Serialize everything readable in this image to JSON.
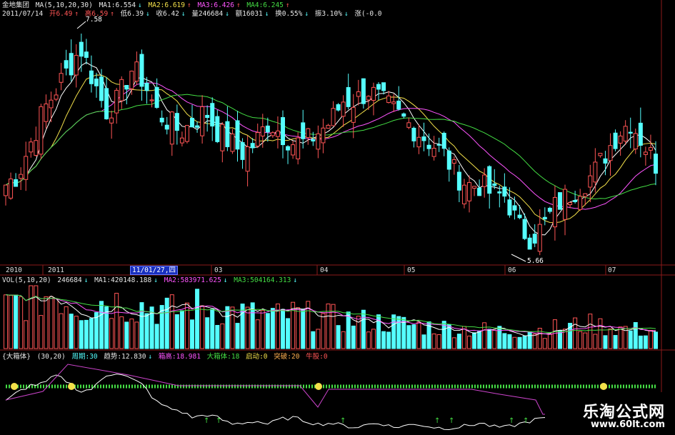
{
  "header": {
    "stock_name": "金地集团",
    "ma_params": "MA(5,10,20,30)",
    "ma1": "MA1:6.554",
    "ma2": "MA2:6.619",
    "ma3": "MA3:6.426",
    "ma4": "MA4:6.245",
    "date": "2011/07/14",
    "open": "开6.49",
    "high": "高6.59",
    "low": "低6.39",
    "close": "收6.42",
    "volume": "量246684",
    "amount": "额16031",
    "turnover": "换0.55%",
    "amplitude": "振3.10%",
    "change": "涨(-0.0"
  },
  "price_labels": {
    "max": "7.58",
    "min": "5.66"
  },
  "x_axis": {
    "labels": [
      "2010",
      "2011",
      "04",
      "05",
      "06",
      "07"
    ],
    "cursor_label": "11/01/27,四",
    "extra_label": "03"
  },
  "volume_header": {
    "params": "VOL(5,10,20)",
    "value": "246684",
    "ma1": "MA1:420148.188",
    "ma2": "MA2:583971.625",
    "ma3": "MA3:504164.313"
  },
  "indicator_header": {
    "name": "{大箱体}",
    "params": "(30,20)",
    "period": "周期:30",
    "trend": "趋势:12.830",
    "box_high": "箱高:18.981",
    "big_box": "大箱体:18",
    "start": "启动:0",
    "breakout": "突破:20",
    "bull": "牛股:0"
  },
  "watermark": {
    "title": "乐淘公式网",
    "url": "www.60lt.com"
  },
  "colors": {
    "up": "#ff5555",
    "down": "#55ffff",
    "ma5": "#ffffff",
    "ma10": "#f3e04a",
    "ma20": "#ff55ff",
    "ma30": "#44dd44",
    "grid": "#8b1a1a"
  },
  "chart_data": {
    "type": "candlestick",
    "x": [
      "2010",
      "2011",
      "11/01/27",
      "03",
      "04",
      "05",
      "06",
      "07"
    ],
    "annotated_high": 7.58,
    "annotated_low": 5.66,
    "ohlc_last": {
      "date": "2011/07/14",
      "open": 6.49,
      "high": 6.59,
      "low": 6.39,
      "close": 6.42
    },
    "ma_last": {
      "MA1": 6.554,
      "MA2": 6.619,
      "MA3": 6.426,
      "MA4": 6.245
    },
    "volume_last": 246684,
    "volume_ma_last": {
      "MA1": 420148.188,
      "MA2": 583971.625,
      "MA3": 504164.313
    },
    "close_series": [
      6.2,
      6.3,
      6.6,
      6.9,
      7.1,
      7.3,
      7.5,
      7.2,
      6.9,
      7.0,
      7.3,
      7.2,
      6.9,
      6.8,
      6.7,
      6.8,
      6.9,
      6.7,
      6.6,
      6.5,
      6.6,
      6.8,
      6.7,
      6.6,
      6.6,
      6.7,
      6.8,
      7.0,
      7.0,
      7.1,
      7.0,
      6.9,
      6.8,
      6.7,
      6.6,
      6.5,
      6.3,
      6.2,
      6.2,
      6.1,
      6.1,
      5.8,
      5.7,
      5.8,
      6.0,
      6.1,
      6.2,
      6.3,
      6.5,
      6.7,
      6.8,
      6.6,
      6.4
    ],
    "volume_series": [
      560,
      640,
      700,
      720,
      780,
      640,
      560,
      610,
      680,
      640,
      600,
      580,
      560,
      520,
      510,
      600,
      560,
      540,
      500,
      480,
      460,
      450,
      440,
      470,
      450,
      430,
      420,
      400,
      390,
      370,
      360,
      350,
      330,
      310,
      300,
      290,
      280,
      270,
      260,
      250,
      240,
      240,
      250,
      260,
      280,
      300,
      320,
      330,
      300,
      280,
      260,
      250,
      247
    ],
    "indicator_series": [
      0.45,
      0.6,
      0.7,
      0.72,
      0.85,
      0.75,
      0.6,
      0.65,
      0.85,
      0.9,
      0.8,
      0.7,
      0.45,
      0.35,
      0.3,
      0.2,
      0.25,
      0.2,
      0.1,
      0.12,
      0.15,
      0.1,
      0.18,
      0.2,
      0.15,
      0.1,
      0.12,
      0.08,
      0.05,
      0.1,
      0.12,
      0.05,
      0.08,
      0.1,
      0.06,
      0.04,
      0.05,
      0.08,
      0.12,
      0.06,
      0.05,
      0.1,
      0.15,
      0.2,
      0.12,
      0.08,
      0.05,
      0.1,
      0.14,
      0.18,
      0.12,
      0.15,
      0.1
    ]
  }
}
